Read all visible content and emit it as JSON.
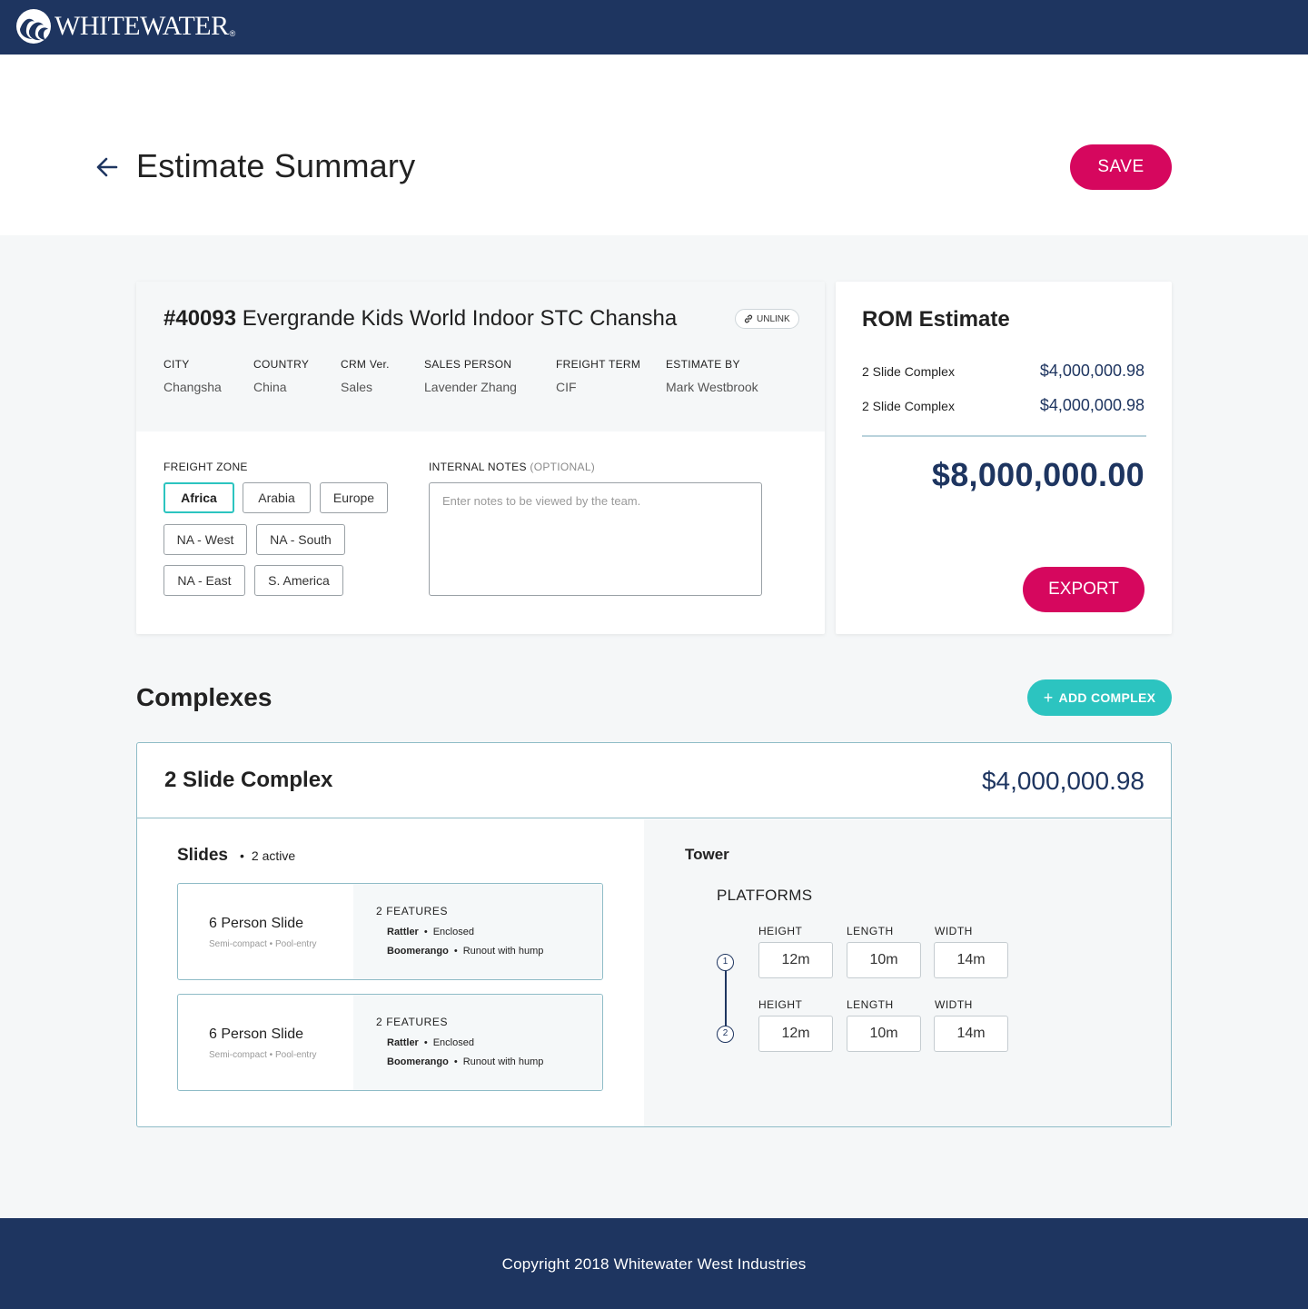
{
  "brand": {
    "name": "WHITEWATER",
    "reg": "®"
  },
  "header": {
    "title": "Estimate Summary",
    "save_label": "SAVE"
  },
  "project": {
    "number": "#40093",
    "name": "Evergrande Kids World Indoor STC Chansha",
    "unlink_label": "UNLINK",
    "meta": [
      {
        "label": "CITY",
        "value": "Changsha"
      },
      {
        "label": "COUNTRY",
        "value": "China"
      },
      {
        "label": "CRM Ver.",
        "value": "Sales"
      },
      {
        "label": "SALES PERSON",
        "value": "Lavender Zhang"
      },
      {
        "label": "FREIGHT TERM",
        "value": "CIF"
      },
      {
        "label": "ESTIMATE BY",
        "value": "Mark Westbrook"
      }
    ],
    "freight_zone_label": "FREIGHT ZONE",
    "zones": [
      "Africa",
      "Arabia",
      "Europe",
      "NA - West",
      "NA - South",
      "NA - East",
      "S. America"
    ],
    "selected_zone": "Africa",
    "notes_label": "INTERNAL NOTES",
    "notes_optional": "(OPTIONAL)",
    "notes_placeholder": "Enter notes to be viewed by the team."
  },
  "rom": {
    "title": "ROM Estimate",
    "items": [
      {
        "name": "2 Slide Complex",
        "value": "$4,000,000.98"
      },
      {
        "name": "2 Slide Complex",
        "value": "$4,000,000.98"
      }
    ],
    "total": "$8,000,000.00",
    "export_label": "EXPORT"
  },
  "complexes": {
    "title": "Complexes",
    "add_label": "ADD COMPLEX",
    "items": [
      {
        "name": "2 Slide Complex",
        "price": "$4,000,000.98",
        "slides_title": "Slides",
        "slides_active": "2 active",
        "slides": [
          {
            "name": "6 Person Slide",
            "sub": "Semi-compact • Pool-entry",
            "features_count": "2 FEATURES",
            "features": [
              {
                "name": "Rattler",
                "value": "Enclosed"
              },
              {
                "name": "Boomerango",
                "value": "Runout with hump"
              }
            ]
          },
          {
            "name": "6 Person Slide",
            "sub": "Semi-compact • Pool-entry",
            "features_count": "2 FEATURES",
            "features": [
              {
                "name": "Rattler",
                "value": "Enclosed"
              },
              {
                "name": "Boomerango",
                "value": "Runout with hump"
              }
            ]
          }
        ],
        "tower_title": "Tower",
        "platforms_title": "PLATFORMS",
        "platforms": [
          {
            "index": "1",
            "height_label": "HEIGHT",
            "length_label": "LENGTH",
            "width_label": "WIDTH",
            "height": "12m",
            "length": "10m",
            "width": "14m"
          },
          {
            "index": "2",
            "height_label": "HEIGHT",
            "length_label": "LENGTH",
            "width_label": "WIDTH",
            "height": "12m",
            "length": "10m",
            "width": "14m"
          }
        ]
      }
    ]
  },
  "footer": {
    "text": "Copyright 2018 Whitewater West Industries"
  },
  "colors": {
    "navy": "#1e3560",
    "pink": "#d6075e",
    "teal": "#2cc4c0"
  }
}
